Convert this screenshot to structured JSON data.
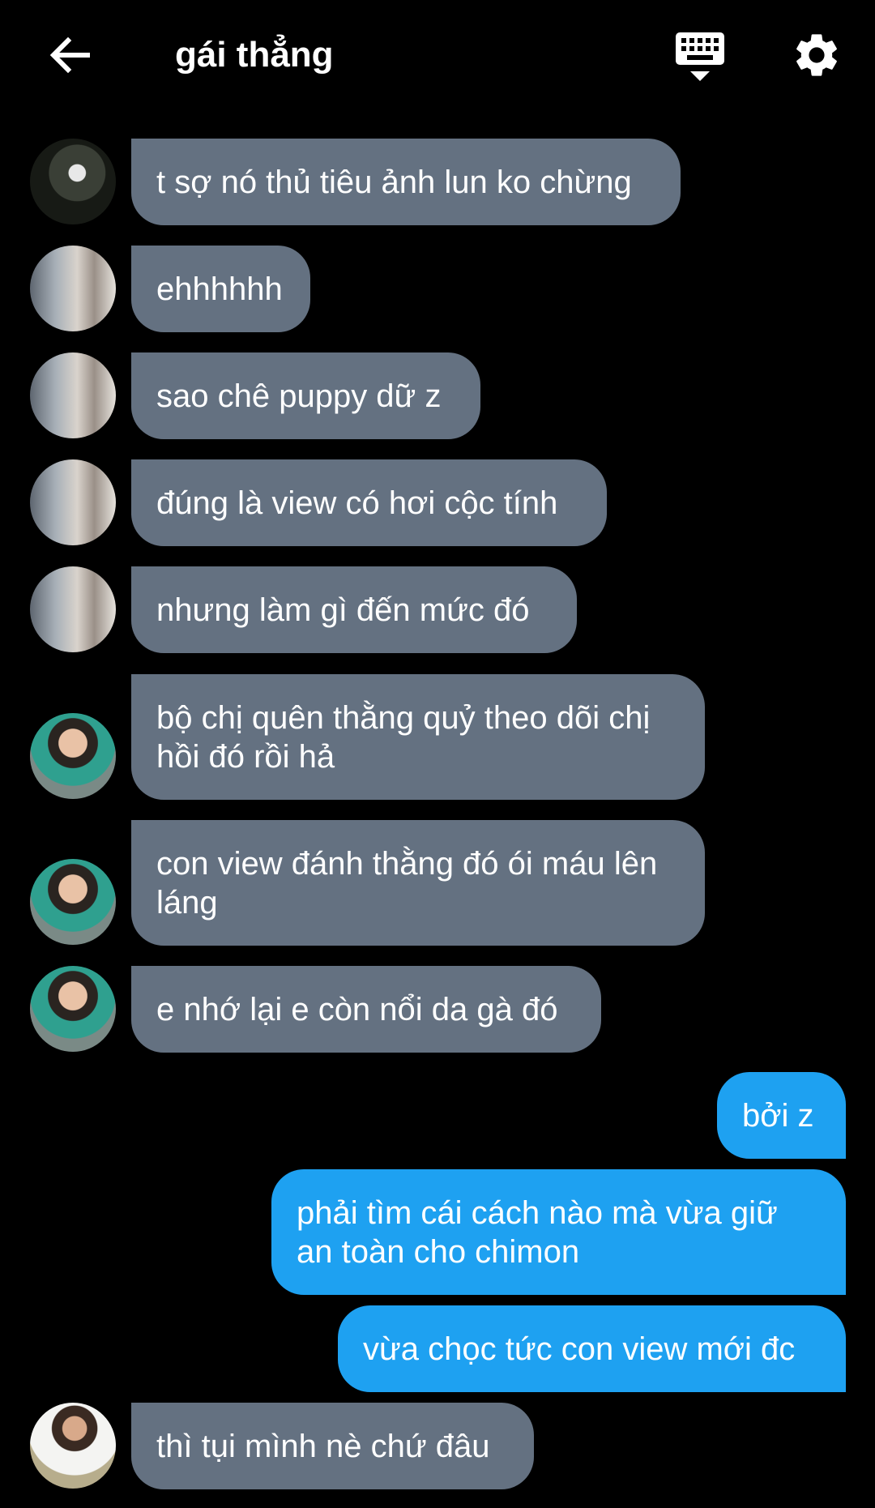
{
  "header": {
    "title": "gái thẳng",
    "back_icon": "arrow-left-icon",
    "keyboard_icon": "keyboard-icon",
    "settings_icon": "gear-icon"
  },
  "colors": {
    "background": "#000000",
    "incoming_bubble": "#647181",
    "outgoing_bubble": "#1ea1f1",
    "text": "#ffffff"
  },
  "messages": [
    {
      "text": "t sợ nó thủ tiêu ảnh lun ko chừng"
    },
    {
      "text": "ehhhhhh"
    },
    {
      "text": "sao chê puppy dữ z"
    },
    {
      "text": "đúng là view có hơi cộc tính"
    },
    {
      "text": "nhưng làm gì đến mức đó"
    },
    {
      "text": "bộ chị quên thằng quỷ theo dõi chị hồi đó rồi hả"
    },
    {
      "text": "con view đánh thằng đó ói máu lên láng"
    },
    {
      "text": "e nhớ lại e còn nổi da gà đó"
    },
    {
      "text": "bởi z"
    },
    {
      "text": "phải tìm cái cách nào mà vừa giữ an toàn cho chimon"
    },
    {
      "text": "vừa chọc tức con view mới đc"
    },
    {
      "text": "thì tụi mình nè chứ đâu"
    }
  ]
}
